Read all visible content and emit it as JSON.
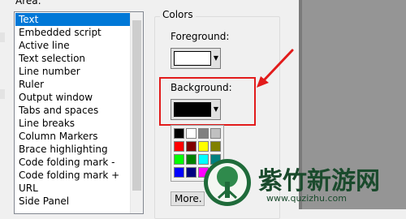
{
  "area": {
    "label": "Area:",
    "items": [
      {
        "label": "Text",
        "selected": true
      },
      {
        "label": "Embedded script"
      },
      {
        "label": "Active line"
      },
      {
        "label": "Text selection"
      },
      {
        "label": "Line number"
      },
      {
        "label": "Ruler"
      },
      {
        "label": "Output window"
      },
      {
        "label": "Tabs and spaces"
      },
      {
        "label": "Line breaks"
      },
      {
        "label": "Column Markers"
      },
      {
        "label": "Brace highlighting"
      },
      {
        "label": "Code folding mark -"
      },
      {
        "label": "Code folding mark +"
      },
      {
        "label": "URL"
      },
      {
        "label": "Side Panel"
      }
    ]
  },
  "colors": {
    "legend": "Colors",
    "foreground_label": "Foreground:",
    "foreground_color": "#ffffff",
    "background_label": "Background:",
    "background_color": "#000000",
    "more_label": "More.",
    "palette": [
      "#000000",
      "#ffffff",
      "#808080",
      "#c0c0c0",
      "#ff0000",
      "#800000",
      "#ffff00",
      "#808000",
      "#00ff00",
      "#008000",
      "#00ffff",
      "#008080",
      "#0000ff",
      "#000080",
      "#ff00ff",
      "#800080"
    ]
  },
  "annotation": {
    "highlight_color": "#e21b1b"
  },
  "watermark": {
    "text": "紫竹新游网",
    "url": "www.quzizhu.com"
  }
}
